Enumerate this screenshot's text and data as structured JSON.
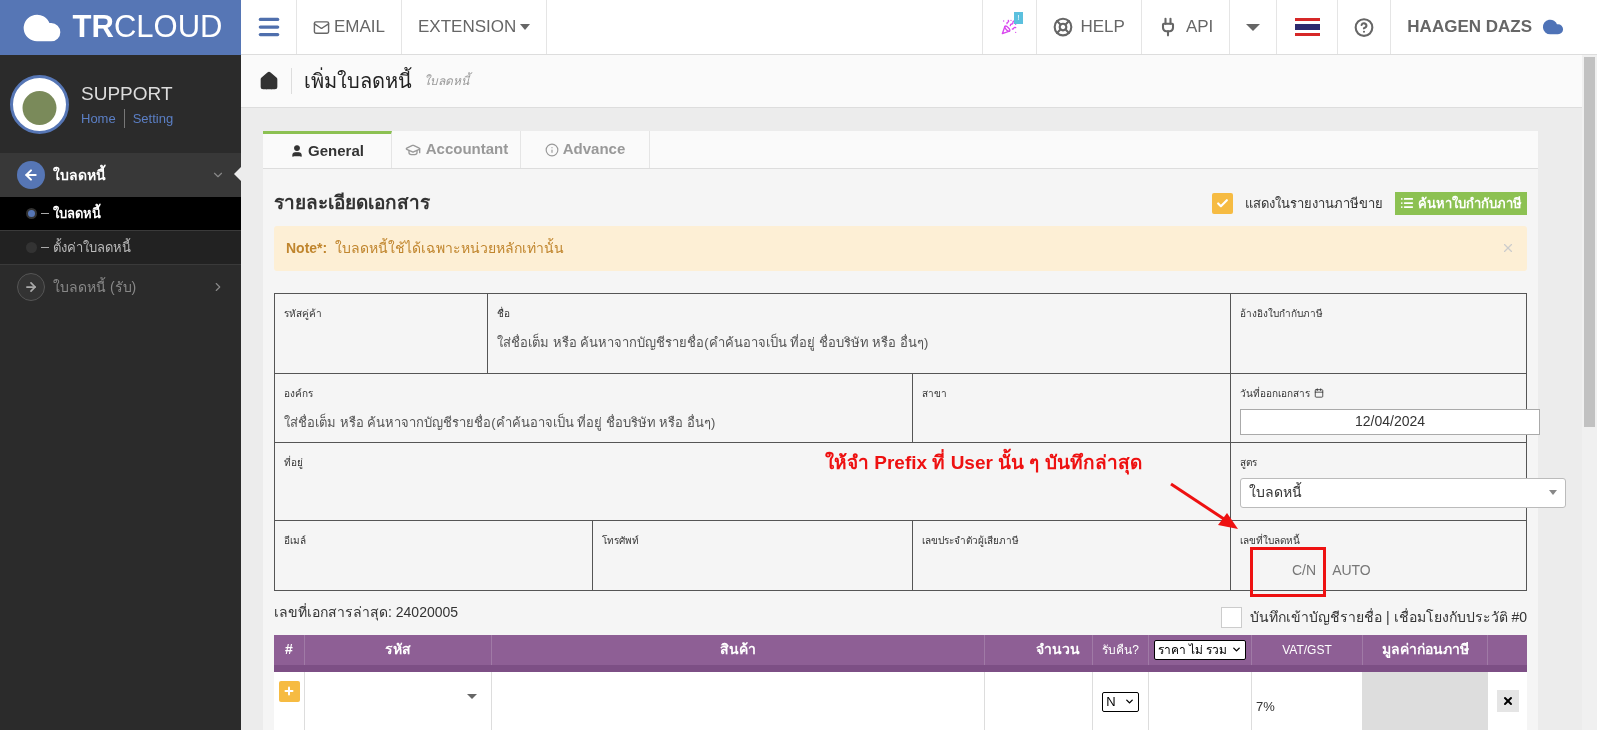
{
  "brand": {
    "bold": "TR",
    "light": "CLOUD"
  },
  "top_left": [
    {
      "kind": "menu"
    },
    {
      "kind": "email",
      "label": "EMAIL"
    },
    {
      "kind": "dropdown",
      "label": "EXTENSION"
    }
  ],
  "top_right": [
    {
      "kind": "party",
      "badge": "!"
    },
    {
      "kind": "help",
      "label": "HELP"
    },
    {
      "kind": "api",
      "label": "API"
    },
    {
      "kind": "caret"
    },
    {
      "kind": "flag"
    },
    {
      "kind": "question"
    },
    {
      "kind": "user",
      "label": "HAAGEN DAZS"
    }
  ],
  "profile": {
    "name": "SUPPORT",
    "links": [
      "Home",
      "Setting"
    ]
  },
  "sidebar": {
    "items": [
      {
        "label": "ใบลดหนี้",
        "expanded": true,
        "children": [
          {
            "label": "ใบลดหนี้",
            "selected": true
          },
          {
            "label": "ตั้งค่าใบลดหนี้",
            "selected": false
          }
        ]
      },
      {
        "label": "ใบลดหนี้ (รับ)",
        "expanded": false
      }
    ]
  },
  "page": {
    "title": "เพิ่มใบลดหนี้",
    "subtitle": "ใบลดหนี้"
  },
  "tabs": [
    {
      "label": "General",
      "kind": "user",
      "selected": true
    },
    {
      "label": "Accountant",
      "kind": "cap",
      "selected": false
    },
    {
      "label": "Advance",
      "kind": "info",
      "selected": false
    }
  ],
  "section_title": "รายละเอียดเอกสาร",
  "show_in_report": {
    "label": "แสดงในรายงานภาษีขาย",
    "checked": true
  },
  "search_button": "ค้นหาใบกำกับภาษี",
  "note": {
    "label": "Note*:",
    "text": "ใบลดหนี้ใช้ได้เฉพาะหน่วยหลักเท่านั้น"
  },
  "form_rows": [
    [
      {
        "label": "รหัสคู่ค้า",
        "kind": "text"
      },
      {
        "label": "ชื่อ",
        "kind": "text",
        "placeholder": "ใส่ชื่อเต็ม หรือ ค้นหาจากบัญชีรายชื่อ(คำค้นอาจเป็น ที่อยู่ ชื่อบริษัท หรือ อื่นๆ)"
      },
      {
        "label": "อ้างอิงใบกำกับภาษี",
        "kind": "text"
      }
    ],
    [
      {
        "label": "องค์กร",
        "kind": "text",
        "placeholder": "ใส่ชื่อเต็ม หรือ ค้นหาจากบัญชีรายชื่อ(คำค้นอาจเป็น ที่อยู่ ชื่อบริษัท หรือ อื่นๆ)"
      },
      {
        "label": "สาขา",
        "kind": "text"
      },
      {
        "label": "วันที่ออกเอกสาร",
        "kind": "date",
        "value": "12/04/2024"
      }
    ],
    [
      {
        "label": "ที่อยู่",
        "kind": "text"
      },
      {
        "label": "สูตร",
        "kind": "select",
        "value": "ใบลดหนี้"
      }
    ],
    [
      {
        "label": "อีเมล์",
        "kind": "text"
      },
      {
        "label": "โทรศัพท์",
        "kind": "text"
      },
      {
        "label": "เลขประจำตัวผู้เสียภาษี",
        "kind": "text"
      },
      {
        "label": "เลขที่ใบลดหนี้",
        "kind": "docno",
        "prefix": "C/N",
        "value": "AUTO"
      }
    ]
  ],
  "annotation": "ให้จำ Prefix ที่ User นั้น ๆ บันทึกล่าสุด",
  "last_doc": "เลขที่เอกสารล่าสุด: 24020005",
  "ledger": {
    "label": "บันทึกเข้าบัญชีรายชื่อ | เชื่อมโยงกับประวัติ #0",
    "checked": false
  },
  "table": {
    "columns": [
      {
        "label": "#",
        "kind": "text"
      },
      {
        "label": "รหัส",
        "kind": "text"
      },
      {
        "label": "สินค้า",
        "kind": "text"
      },
      {
        "label": "จำนวน",
        "kind": "text"
      },
      {
        "label": "รับคืน?",
        "kind": "text"
      },
      {
        "label": "ราคา ไม่ รวม",
        "kind": "select"
      },
      {
        "label": "VAT/GST",
        "kind": "text"
      },
      {
        "label": "มูลค่าก่อนภาษี",
        "kind": "text"
      }
    ],
    "rows": [
      {
        "return": "N",
        "vat": "7%"
      }
    ]
  }
}
